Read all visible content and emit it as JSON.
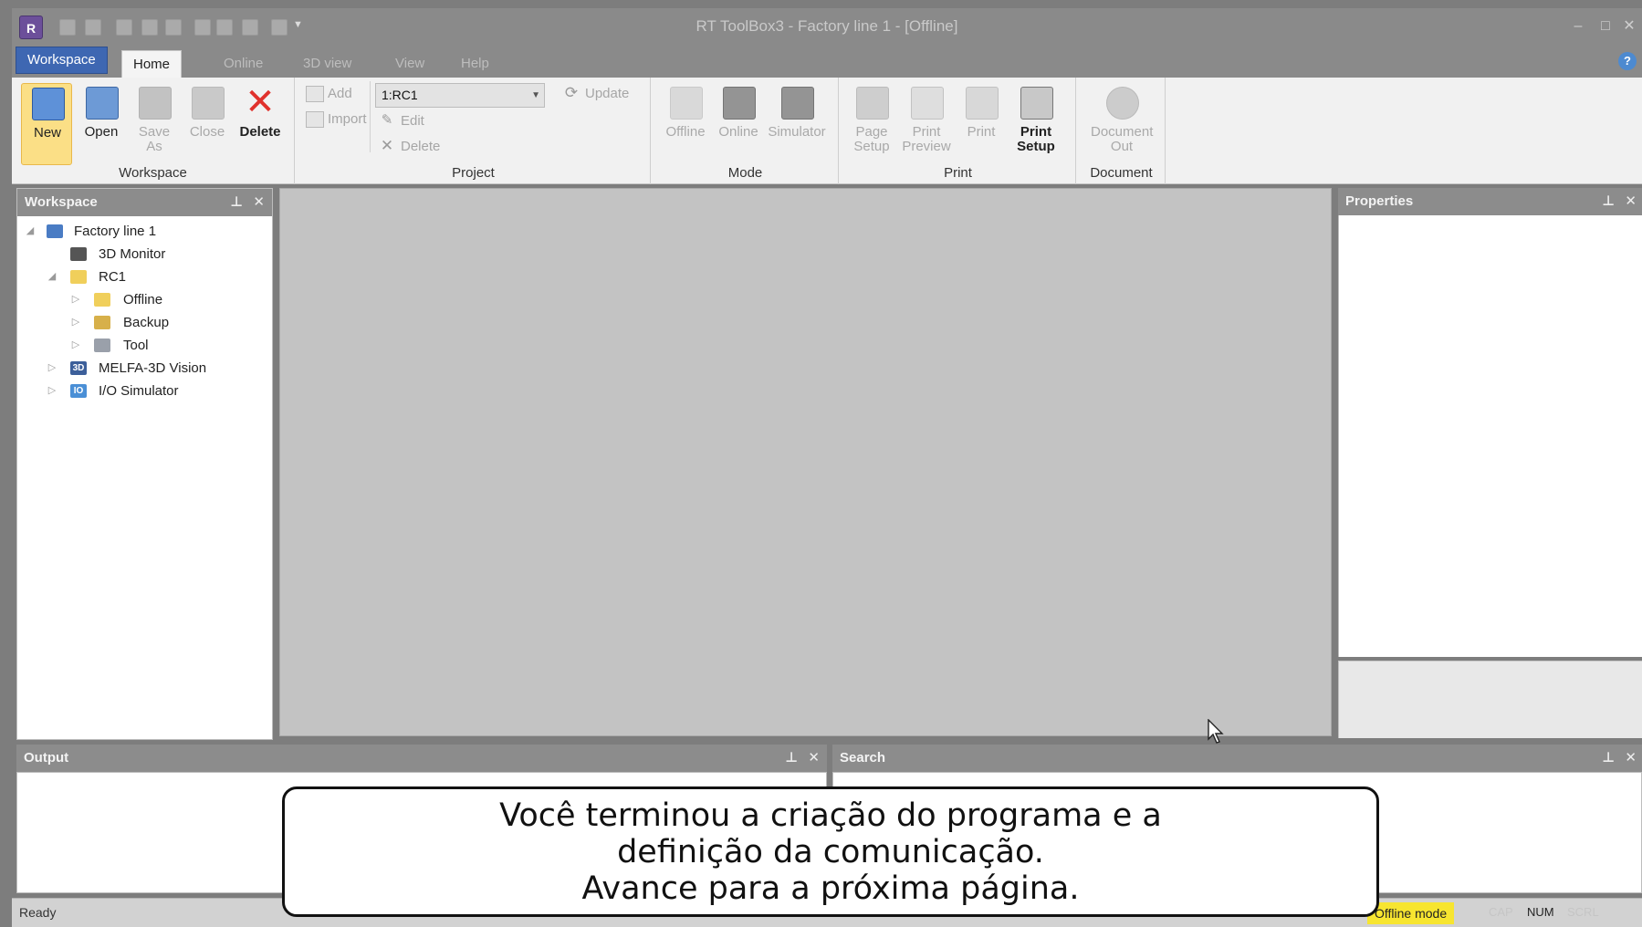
{
  "window": {
    "title": "RT ToolBox3 - Factory line 1 - [Offline]",
    "controls": [
      "–",
      "□",
      "✕"
    ]
  },
  "ribbon_tabs": [
    {
      "label": "Workspace"
    },
    {
      "label": "Home"
    },
    {
      "label": "Online"
    },
    {
      "label": "3D view"
    },
    {
      "label": "View"
    },
    {
      "label": "Help"
    }
  ],
  "ribbon": {
    "workspace_group": {
      "label": "Workspace",
      "new": "New",
      "open": "Open",
      "save_as": "Save\nAs",
      "close": "Close",
      "delete": "Delete"
    },
    "project_group": {
      "label": "Project",
      "add": "Add",
      "import": "Import",
      "combo_value": "1:RC1",
      "update": "Update",
      "edit": "Edit",
      "delete": "Delete"
    },
    "mode_group": {
      "label": "Mode",
      "offline": "Offline",
      "online": "Online",
      "simulator": "Simulator"
    },
    "print_group": {
      "label": "Print",
      "page_setup": "Page\nSetup",
      "print_preview": "Print\nPreview",
      "print": "Print",
      "print_setup": "Print\nSetup"
    },
    "document_group": {
      "label": "Document",
      "document_out": "Document\nOut"
    }
  },
  "workspace_panel": {
    "title": "Workspace",
    "tree": [
      {
        "label": "Factory line 1",
        "expander": "◢"
      },
      {
        "label": "3D Monitor",
        "expander": ""
      },
      {
        "label": "RC1",
        "expander": "◢"
      },
      {
        "label": "Offline",
        "expander": "▷"
      },
      {
        "label": "Backup",
        "expander": "▷"
      },
      {
        "label": "Tool",
        "expander": "▷"
      },
      {
        "label": "MELFA-3D Vision",
        "expander": "▷",
        "icon_text": "3D"
      },
      {
        "label": "I/O Simulator",
        "expander": "▷",
        "icon_text": "IO"
      }
    ]
  },
  "properties_panel": {
    "title": "Properties"
  },
  "output_panel": {
    "title": "Output"
  },
  "search_panel": {
    "title": "Search"
  },
  "panel_buttons": {
    "pin": "p",
    "close": "✕"
  },
  "statusbar": {
    "ready": "Ready",
    "mode": "Offline mode",
    "cap": "CAP",
    "num": "NUM",
    "scrl": "SCRL"
  },
  "caption": {
    "line1": "Você terminou a criação do programa e a",
    "line2": "definição da comunicação.",
    "line3": "Avance para a próxima página."
  },
  "colors": {
    "accent": "#3e67b2",
    "offline_badge": "#f7e530",
    "new_highlight": "#fbdf86",
    "delete_red": "#e0312c"
  }
}
